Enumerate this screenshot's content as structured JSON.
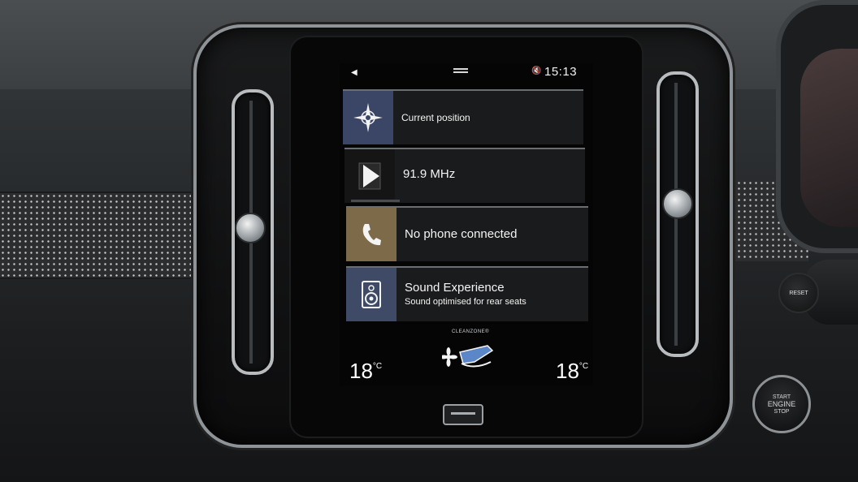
{
  "status_bar": {
    "back_icon": "back-arrow-icon",
    "volume_icon": "speaker-muted-icon",
    "clock": "15:13"
  },
  "tiles": [
    {
      "id": "navigation",
      "icon": "compass-icon",
      "label": "Current position",
      "icon_bg": "#3b4566"
    },
    {
      "id": "radio",
      "icon": "play-icon",
      "label": "91.9 MHz",
      "icon_bg": "#151516"
    },
    {
      "id": "phone",
      "icon": "phone-handset-icon",
      "label": "No phone connected",
      "icon_bg": "#7d6a49"
    },
    {
      "id": "sound",
      "icon": "speaker-icon",
      "label": "Sound Experience",
      "sublabel": "Sound optimised for rear seats",
      "icon_bg": "#3f4a66"
    }
  ],
  "climate": {
    "brand": "CLEANZONE®",
    "left_temp": "18",
    "right_temp": "18",
    "unit": "°C",
    "seat_icon": "seat-airflow-icon"
  },
  "controls": {
    "reset_label": "RESET",
    "start_line1": "START",
    "start_line2": "ENGINE",
    "start_line3": "STOP"
  }
}
